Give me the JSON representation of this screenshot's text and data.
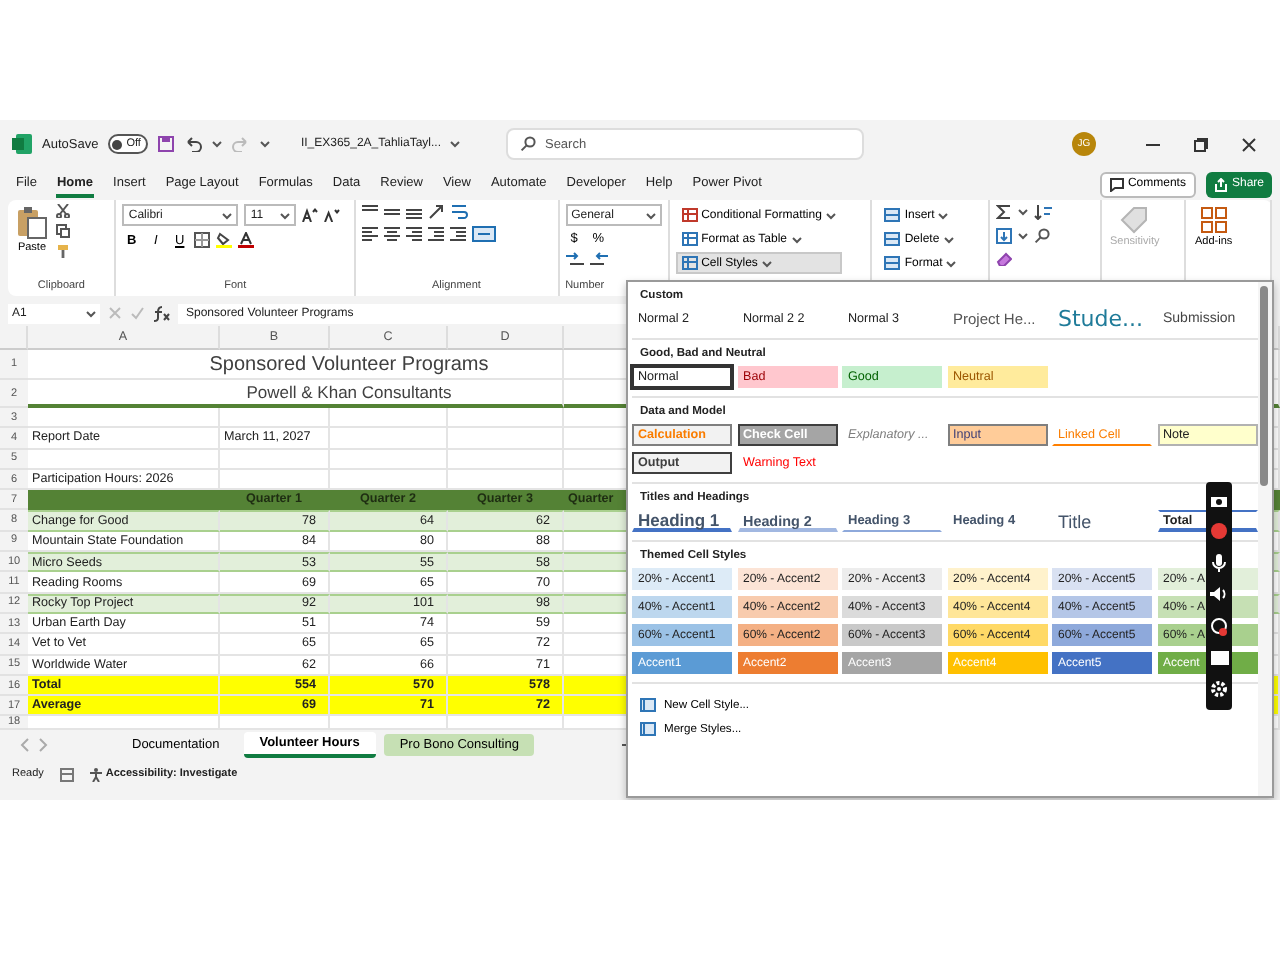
{
  "title_bar": {
    "autosave_label": "AutoSave",
    "autosave": {
      "on": false,
      "label": "Off"
    },
    "file_name": "II_EX365_2A_TahliaTayl...",
    "search_placeholder": "Search",
    "avatar": "JG"
  },
  "menu_tabs": [
    {
      "label": "File",
      "selected": false
    },
    {
      "label": "Home",
      "selected": true
    },
    {
      "label": "Insert",
      "selected": false
    },
    {
      "label": "Page Layout",
      "selected": false
    },
    {
      "label": "Formulas",
      "selected": false
    },
    {
      "label": "Data",
      "selected": false
    },
    {
      "label": "Review",
      "selected": false
    },
    {
      "label": "View",
      "selected": false
    },
    {
      "label": "Automate",
      "selected": false
    },
    {
      "label": "Developer",
      "selected": false
    },
    {
      "label": "Help",
      "selected": false
    },
    {
      "label": "Power Pivot",
      "selected": false
    }
  ],
  "comments_button": "Comments",
  "share_button": "Share",
  "ribbon": {
    "paste": "Paste",
    "font_name": "Calibri",
    "font_size": "11",
    "font_buttons": [
      "B",
      "I",
      "U"
    ],
    "number_format": "General",
    "number_buttons": [
      "$",
      "%"
    ],
    "group_labels": [
      "Clipboard",
      "Font",
      "Alignment",
      "Number"
    ],
    "styles_buttons": [
      {
        "label": "Conditional Formatting",
        "pressed": false
      },
      {
        "label": "Format as Table",
        "pressed": false
      },
      {
        "label": "Cell Styles",
        "pressed": true
      }
    ],
    "cells_buttons": [
      "Insert",
      "Delete",
      "Format"
    ],
    "sensitivity": {
      "label": "Sensitivity",
      "disabled": true
    },
    "addins": "Add-ins"
  },
  "formula_bar": {
    "name_box": "A1",
    "formula": "Sponsored Volunteer Programs"
  },
  "sheet": {
    "columns": [
      "A",
      "B",
      "C",
      "D"
    ],
    "rows": [
      {
        "number": "1",
        "kind": "title",
        "cells": [
          "Sponsored Volunteer Programs"
        ]
      },
      {
        "number": "2",
        "kind": "subtitle",
        "cells": [
          "Powell & Khan Consultants"
        ]
      },
      {
        "number": "3",
        "kind": "blank",
        "cells": []
      },
      {
        "number": "4",
        "kind": "label",
        "cells": [
          "Report Date",
          "March 11, 2027"
        ]
      },
      {
        "number": "5",
        "kind": "blank",
        "cells": []
      },
      {
        "number": "6",
        "kind": "label",
        "cells": [
          "Participation Hours: 2026"
        ]
      },
      {
        "number": "7",
        "kind": "header",
        "cells": [
          "",
          "Quarter 1",
          "Quarter 2",
          "Quarter 3",
          "Quarter"
        ]
      },
      {
        "number": "8",
        "kind": "data",
        "shaded": true,
        "cells": [
          "Change for Good",
          "78",
          "64",
          "62"
        ]
      },
      {
        "number": "9",
        "kind": "data",
        "shaded": false,
        "cells": [
          "Mountain State Foundation",
          "84",
          "80",
          "88"
        ]
      },
      {
        "number": "10",
        "kind": "data",
        "shaded": true,
        "cells": [
          "Micro Seeds",
          "53",
          "55",
          "58"
        ]
      },
      {
        "number": "11",
        "kind": "data",
        "shaded": false,
        "cells": [
          "Reading Rooms",
          "69",
          "65",
          "70"
        ]
      },
      {
        "number": "12",
        "kind": "data",
        "shaded": true,
        "cells": [
          "Rocky Top Project",
          "92",
          "101",
          "98"
        ]
      },
      {
        "number": "13",
        "kind": "data",
        "shaded": false,
        "cells": [
          "Urban Earth Day",
          "51",
          "74",
          "59"
        ]
      },
      {
        "number": "14",
        "kind": "data",
        "shaded": false,
        "cells": [
          "Vet to Vet",
          "65",
          "65",
          "72"
        ]
      },
      {
        "number": "15",
        "kind": "data",
        "shaded": false,
        "cells": [
          "Worldwide Water",
          "62",
          "66",
          "71"
        ]
      },
      {
        "number": "16",
        "kind": "total",
        "cells": [
          "Total",
          "554",
          "570",
          "578"
        ]
      },
      {
        "number": "17",
        "kind": "total",
        "cells": [
          "Average",
          "69",
          "71",
          "72"
        ]
      },
      {
        "number": "18",
        "kind": "blank",
        "cells": []
      }
    ]
  },
  "sheet_tabs": [
    {
      "label": "Documentation",
      "selected": false
    },
    {
      "label": "Volunteer Hours",
      "selected": true
    },
    {
      "label": "Pro Bono Consulting",
      "selected": false,
      "color": "#c6e0b4"
    }
  ],
  "status_bar": {
    "mode": "Ready",
    "accessibility": "Accessibility: Investigate"
  },
  "cell_styles_gallery": {
    "sections": [
      {
        "title": "Custom",
        "styles": [
          {
            "label": "Normal 2",
            "kind": "plain",
            "selected": false
          },
          {
            "label": "Normal 2 2",
            "kind": "plain",
            "selected": false
          },
          {
            "label": "Normal 3",
            "kind": "plain",
            "selected": false
          },
          {
            "label": "Project He...",
            "kind": "project",
            "selected": false
          },
          {
            "label": "Stude...",
            "kind": "student",
            "selected": false
          },
          {
            "label": "Submission",
            "kind": "submission",
            "selected": false
          }
        ]
      },
      {
        "title": "Good, Bad and Neutral",
        "styles": [
          {
            "label": "Normal",
            "kind": "plain",
            "selected": true
          },
          {
            "label": "Bad",
            "kind": "bad",
            "selected": false
          },
          {
            "label": "Good",
            "kind": "good",
            "selected": false
          },
          {
            "label": "Neutral",
            "kind": "neutral",
            "selected": false
          }
        ]
      },
      {
        "title": "Data and Model",
        "styles": [
          {
            "label": "Calculation",
            "kind": "calculation",
            "selected": false
          },
          {
            "label": "Check Cell",
            "kind": "check",
            "selected": false
          },
          {
            "label": "Explanatory ...",
            "kind": "explanatory",
            "selected": false
          },
          {
            "label": "Input",
            "kind": "input",
            "selected": false
          },
          {
            "label": "Linked Cell",
            "kind": "linked",
            "selected": false
          },
          {
            "label": "Note",
            "kind": "note",
            "selected": false
          },
          {
            "label": "Output",
            "kind": "output",
            "selected": false
          },
          {
            "label": "Warning Text",
            "kind": "warning",
            "selected": false
          }
        ]
      },
      {
        "title": "Titles and Headings",
        "styles": [
          {
            "label": "Heading 1",
            "kind": "h1",
            "selected": false
          },
          {
            "label": "Heading 2",
            "kind": "h2",
            "selected": false
          },
          {
            "label": "Heading 3",
            "kind": "h3",
            "selected": false
          },
          {
            "label": "Heading 4",
            "kind": "h4",
            "selected": false
          },
          {
            "label": "Title",
            "kind": "title",
            "selected": false
          },
          {
            "label": "Total",
            "kind": "total",
            "selected": false
          }
        ]
      },
      {
        "title": "Themed Cell Styles",
        "styles": [
          {
            "label": "20% - Accent1",
            "kind": "tint",
            "color": "#ddebf7",
            "selected": false
          },
          {
            "label": "20% - Accent2",
            "kind": "tint",
            "color": "#fce4d6",
            "selected": false
          },
          {
            "label": "20% - Accent3",
            "kind": "tint",
            "color": "#ededed",
            "selected": false
          },
          {
            "label": "20% - Accent4",
            "kind": "tint",
            "color": "#fff2cc",
            "selected": false
          },
          {
            "label": "20% - Accent5",
            "kind": "tint",
            "color": "#d9e1f2",
            "selected": false
          },
          {
            "label": "20% - A",
            "kind": "tint",
            "color": "#e2efda",
            "selected": false
          },
          {
            "label": "40% - Accent1",
            "kind": "tint",
            "color": "#bdd7ee",
            "selected": false
          },
          {
            "label": "40% - Accent2",
            "kind": "tint",
            "color": "#f8cbad",
            "selected": false
          },
          {
            "label": "40% - Accent3",
            "kind": "tint",
            "color": "#dbdbdb",
            "selected": false
          },
          {
            "label": "40% - Accent4",
            "kind": "tint",
            "color": "#ffe699",
            "selected": false
          },
          {
            "label": "40% - Accent5",
            "kind": "tint",
            "color": "#b4c6e7",
            "selected": false
          },
          {
            "label": "40% - A",
            "kind": "tint",
            "color": "#c6e0b4",
            "selected": false
          },
          {
            "label": "60% - Accent1",
            "kind": "tint",
            "color": "#9bc2e6",
            "selected": false
          },
          {
            "label": "60% - Accent2",
            "kind": "tint",
            "color": "#f4b084",
            "selected": false
          },
          {
            "label": "60% - Accent3",
            "kind": "tint",
            "color": "#c9c9c9",
            "selected": false
          },
          {
            "label": "60% - Accent4",
            "kind": "tint",
            "color": "#ffd966",
            "selected": false
          },
          {
            "label": "60% - Accent5",
            "kind": "tint",
            "color": "#8ea9db",
            "selected": false
          },
          {
            "label": "60% - A",
            "kind": "tint",
            "color": "#a9d08e",
            "selected": false
          },
          {
            "label": "Accent1",
            "kind": "accent",
            "color": "#5b9bd5",
            "selected": false
          },
          {
            "label": "Accent2",
            "kind": "accent",
            "color": "#ed7d31",
            "selected": false
          },
          {
            "label": "Accent3",
            "kind": "accent",
            "color": "#a5a5a5",
            "selected": false
          },
          {
            "label": "Accent4",
            "kind": "accent",
            "color": "#ffc000",
            "selected": false
          },
          {
            "label": "Accent5",
            "kind": "accent",
            "color": "#4472c4",
            "selected": false
          },
          {
            "label": "Accent",
            "kind": "accent",
            "color": "#70ad47",
            "selected": false
          }
        ]
      }
    ],
    "commands": [
      "New Cell Style...",
      "Merge Styles..."
    ]
  }
}
